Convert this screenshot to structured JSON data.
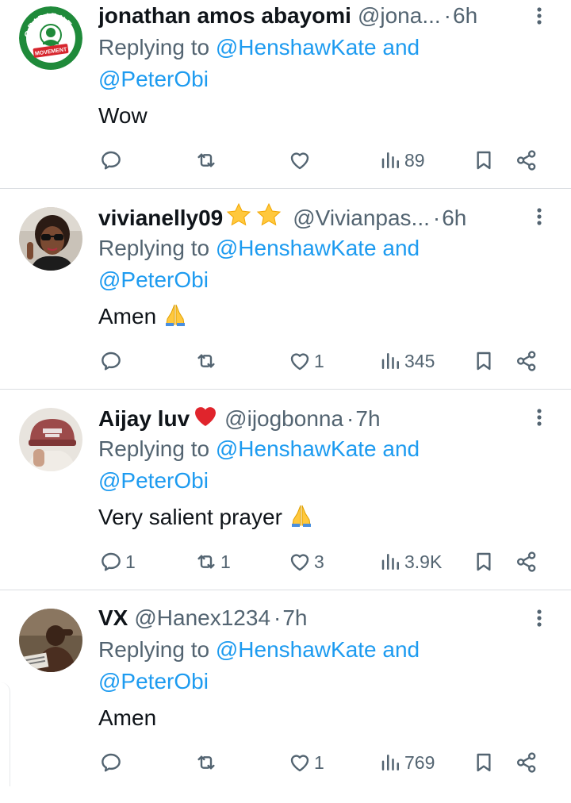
{
  "replies": [
    {
      "name": "jonathan amos abayomi",
      "name_emojis": "",
      "handle": "@jona...",
      "time": "6h",
      "reply_prefix": "Replying to ",
      "mention_1": "@HenshawKate and",
      "mention_2": "@PeterObi",
      "text": "Wow",
      "has_pray_emoji": false,
      "avatar_icon": "obident-movement-logo",
      "avatar_text_top": "OBIDIENT",
      "avatar_text_bottom": "MOVEMENT",
      "counts": {
        "replies": "",
        "reposts": "",
        "likes": "",
        "views": "89"
      }
    },
    {
      "name": "vivianelly09",
      "name_emojis": "⭐⭐",
      "handle": "@Vivianpas...",
      "time": "6h",
      "reply_prefix": "Replying to ",
      "mention_1": "@HenshawKate and",
      "mention_2": "@PeterObi",
      "text": "Amen",
      "has_pray_emoji": true,
      "avatar_icon": "woman-with-sunglasses-photo",
      "counts": {
        "replies": "",
        "reposts": "",
        "likes": "1",
        "views": "345"
      }
    },
    {
      "name": "Aijay luv",
      "name_emojis": "❤️",
      "handle": "@ijogbonna",
      "time": "7h",
      "reply_prefix": "Replying to ",
      "mention_1": "@HenshawKate and",
      "mention_2": "@PeterObi",
      "text": "Very salient prayer",
      "has_pray_emoji": true,
      "avatar_icon": "person-with-cap-photo",
      "counts": {
        "replies": "1",
        "reposts": "1",
        "likes": "3",
        "views": "3.9K"
      }
    },
    {
      "name": "VX",
      "name_emojis": "",
      "handle": "@Hanex1234",
      "time": "7h",
      "reply_prefix": "Replying to ",
      "mention_1": "@HenshawKate and",
      "mention_2": "@PeterObi",
      "text": "Amen",
      "has_pray_emoji": false,
      "avatar_icon": "man-relaxing-photo",
      "counts": {
        "replies": "",
        "reposts": "",
        "likes": "1",
        "views": "769"
      }
    }
  ],
  "separator": "·",
  "colors": {
    "text": "#0f1419",
    "secondary": "#536471",
    "accent": "#1d9bf0",
    "divider": "#dadde1"
  }
}
